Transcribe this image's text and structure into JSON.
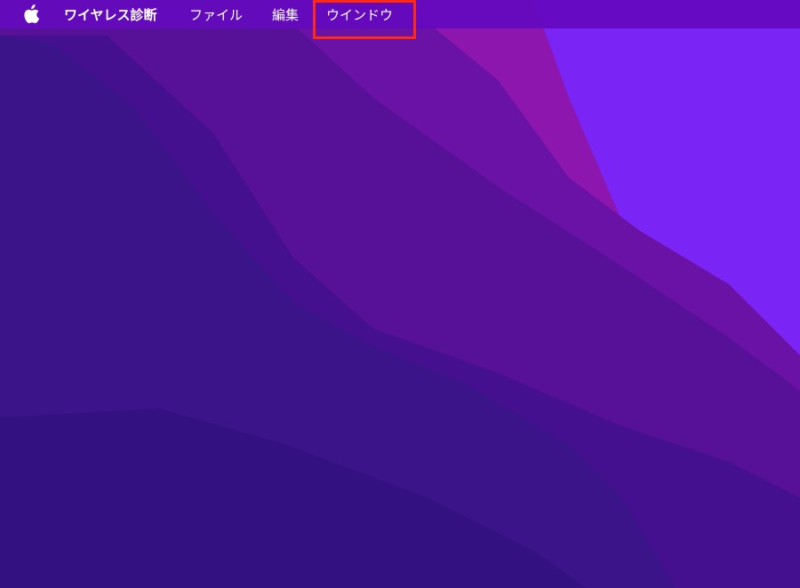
{
  "menubar": {
    "apple_icon": "apple-logo-icon",
    "app_name": "ワイヤレス診断",
    "items": [
      {
        "label": "ファイル"
      },
      {
        "label": "編集"
      },
      {
        "label": "ウインドウ"
      }
    ]
  },
  "highlight": {
    "target": "ウインドウ",
    "color": "#ff2a10"
  },
  "colors": {
    "menubar": "#640abe",
    "wallpaper_dark": "#3a1490",
    "wallpaper_accent": "#7a24f5"
  }
}
